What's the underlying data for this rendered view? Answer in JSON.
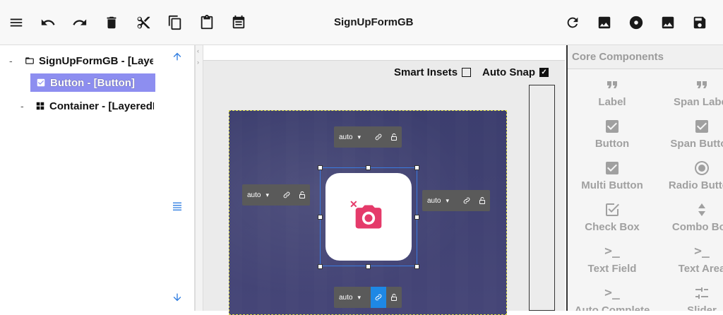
{
  "app": {
    "title": "SignUpFormGB"
  },
  "toolbar": {
    "left_icons": [
      "menu-icon",
      "undo-icon",
      "redo-icon",
      "delete-icon",
      "cut-icon",
      "copy-icon",
      "paste-icon",
      "clipboard-list-icon"
    ],
    "right_icons": [
      "refresh-icon",
      "image-icon",
      "record-icon",
      "image-alt-icon",
      "save-icon"
    ]
  },
  "tree": {
    "items": [
      {
        "toggle": "-",
        "label": "SignUpFormGB - [Laye",
        "icon": "folder-open-icon",
        "selected": false
      },
      {
        "toggle": "",
        "label": "Button - [Button]",
        "icon": "checkbox-icon",
        "selected": true
      },
      {
        "toggle": "-",
        "label": "Container - [LayeredL",
        "icon": "grid-icon",
        "selected": false
      }
    ]
  },
  "canvas": {
    "smart_insets_label": "Smart Insets",
    "smart_insets_checked": false,
    "auto_snap_label": "Auto Snap",
    "auto_snap_checked": true,
    "anchors": {
      "top": {
        "value": "auto",
        "linked": false
      },
      "left": {
        "value": "auto",
        "linked": false
      },
      "right": {
        "value": "auto",
        "linked": false
      },
      "bottom": {
        "value": "auto",
        "linked": true
      }
    },
    "selected_icon": "camera-icon"
  },
  "components": {
    "header": "Core Components",
    "items": [
      {
        "label": "Label",
        "icon": "quote-icon"
      },
      {
        "label": "Span Label",
        "icon": "quote-icon"
      },
      {
        "label": "Button",
        "icon": "checkbox-icon"
      },
      {
        "label": "Span Button",
        "icon": "checkbox-icon"
      },
      {
        "label": "Multi Button",
        "icon": "checkbox-icon"
      },
      {
        "label": "Radio Button",
        "icon": "radio-icon"
      },
      {
        "label": "Check Box",
        "icon": "check-outline-icon"
      },
      {
        "label": "Combo Box",
        "icon": "updown-icon"
      },
      {
        "label": "Text Field",
        "icon": "terminal-icon"
      },
      {
        "label": "Text Area",
        "icon": "terminal-icon"
      },
      {
        "label": "Auto Complete",
        "icon": "terminal-icon"
      },
      {
        "label": "Slider",
        "icon": "sliders-icon"
      }
    ]
  }
}
